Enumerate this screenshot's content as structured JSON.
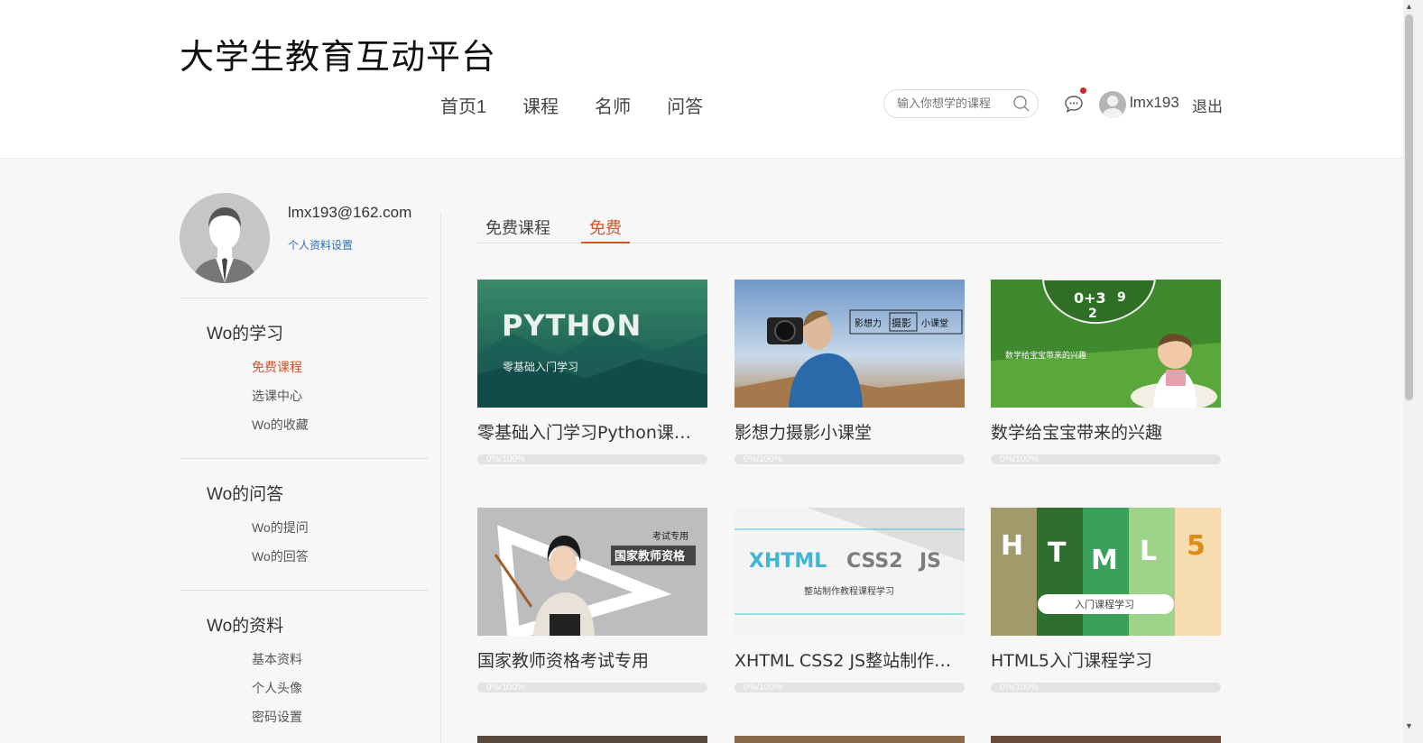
{
  "header": {
    "logo": "大学生教育互动平台",
    "nav": [
      "首页1",
      "课程",
      "名师",
      "问答"
    ],
    "search_placeholder": "输入你想学的课程",
    "username": "lmx193",
    "logout": "退出"
  },
  "profile": {
    "email": "lmx193@162.com",
    "settings_link": "个人资料设置"
  },
  "sidebar": {
    "sections": [
      {
        "title": "Wo的学习",
        "items": [
          "免费课程",
          "选课中心",
          "Wo的收藏"
        ],
        "active": 0
      },
      {
        "title": "Wo的问答",
        "items": [
          "Wo的提问",
          "Wo的回答"
        ]
      },
      {
        "title": "Wo的资料",
        "items": [
          "基本资料",
          "个人头像",
          "密码设置"
        ]
      }
    ]
  },
  "tabs": [
    {
      "label": "免费课程",
      "active": false
    },
    {
      "label": "免费",
      "active": true
    }
  ],
  "courses": [
    {
      "title": "零基础入门学习Python课程学...",
      "progress": 0,
      "progress_text": "0%/100%",
      "thumb_text": [
        "PYTHON",
        "零基础入门学习"
      ]
    },
    {
      "title": "影想力摄影小课堂",
      "progress": 0,
      "progress_text": "0%/100%",
      "thumb_text": [
        "影想力",
        "摄影",
        "小课堂"
      ]
    },
    {
      "title": "数学给宝宝带来的兴趣",
      "progress": 0,
      "progress_text": "0%/100%",
      "thumb_text": [
        "数学给宝宝带来的兴趣",
        "0+3",
        "9",
        "2"
      ]
    },
    {
      "title": "国家教师资格考试专用",
      "progress": 0,
      "progress_text": "0%/100%",
      "thumb_text": [
        "考试专用",
        "国家教师资格"
      ]
    },
    {
      "title": "XHTML CSS2 JS整站制作教...",
      "progress": 0,
      "progress_text": "0%/100%",
      "thumb_text": [
        "XHTML",
        "CSS2",
        "JS",
        "整站制作教程课程学习"
      ]
    },
    {
      "title": "HTML5入门课程学习",
      "progress": 0,
      "progress_text": "0%/100%",
      "thumb_text": [
        "H",
        "T",
        "M",
        "L",
        "5",
        "入门课程学习"
      ]
    }
  ],
  "colors": {
    "accent": "#d0552b",
    "link": "#2d6fbf",
    "notification_dot": "#d0292b"
  },
  "icons": [
    "search-icon",
    "message-icon",
    "user-avatar-icon",
    "default-avatar-icon",
    "scroll-up-icon",
    "scroll-down-icon"
  ]
}
